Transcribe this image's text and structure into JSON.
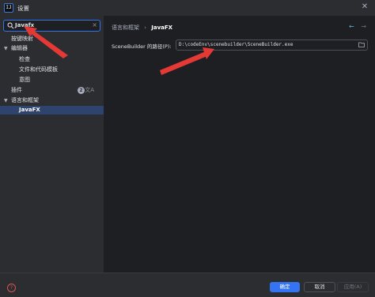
{
  "window": {
    "logo_text": "IJ",
    "title": "设置"
  },
  "sidebar": {
    "search_value": "Javafx",
    "items": [
      {
        "label": "按键映射"
      },
      {
        "label": "编辑器"
      },
      {
        "label": "检查"
      },
      {
        "label": "文件和代码模板"
      },
      {
        "label": "意图"
      },
      {
        "label": "插件"
      },
      {
        "label": "语言和框架"
      },
      {
        "label": "JavaFX"
      }
    ],
    "plugins_badge": "2"
  },
  "main": {
    "breadcrumb_parent": "语言和框架",
    "breadcrumb_sep": "›",
    "breadcrumb_current": "JavaFX",
    "field_label": "SceneBuilder 的路径(P):",
    "field_value": "D:\\codeEnv\\scenebuilder\\SceneBuilder.exe"
  },
  "footer": {
    "ok": "确定",
    "cancel": "取消",
    "apply": "应用(A)"
  },
  "colors": {
    "accent": "#3574f0",
    "annotation": "#e53935",
    "selection": "#2e436e"
  }
}
